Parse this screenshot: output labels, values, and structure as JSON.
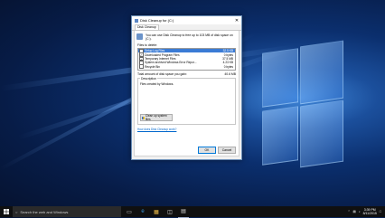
{
  "dialog": {
    "title": "Disk Cleanup for  (C:)",
    "close_glyph": "✕",
    "tab": "Disk Cleanup",
    "intro": "You can use Disk Cleanup to free up to 103 MB of disk space on  (C:).",
    "files_label": "Files to delete:",
    "files": [
      {
        "name": "Setup Log Files",
        "size": "32.5 KB",
        "checked": true,
        "selected": true
      },
      {
        "name": "Downloaded Program Files",
        "size": "0 bytes",
        "checked": true,
        "selected": false
      },
      {
        "name": "Temporary Internet Files",
        "size": "37.5 MB",
        "checked": true,
        "selected": false
      },
      {
        "name": "System archived Windows Error Repor...",
        "size": "4.23 KB",
        "checked": false,
        "selected": false
      },
      {
        "name": "Recycle Bin",
        "size": "0 bytes",
        "checked": false,
        "selected": false
      }
    ],
    "total_label": "Total amount of disk space you gain:",
    "total_value": "40.6 MB",
    "description_label": "Description",
    "description_text": "Files created by Windows.",
    "cleanup_system_label": "Clean up system files",
    "link_text": "How does Disk Cleanup work?",
    "ok_label": "OK",
    "cancel_label": "Cancel"
  },
  "taskbar": {
    "search_placeholder": "Search the web and Windows",
    "time": "3:39 PM",
    "date": "8/11/2015"
  },
  "colors": {
    "accent": "#0078d7",
    "selection": "#3a7bd5"
  }
}
